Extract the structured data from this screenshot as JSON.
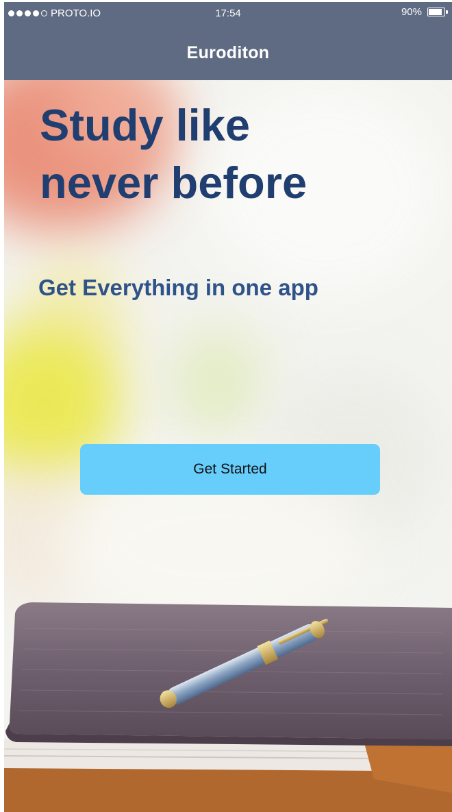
{
  "status_bar": {
    "carrier": "PROTO.IO",
    "time": "17:54",
    "battery": "90%"
  },
  "header": {
    "title": "Euroditon"
  },
  "hero": {
    "headline_line1": "Study like",
    "headline_line2": "never before",
    "subheadline": "Get Everything in one app",
    "cta_label": "Get Started"
  },
  "colors": {
    "header_bg": "#5f6b82",
    "headline": "#203e70",
    "subheadline": "#2f5289",
    "cta_bg": "#67cdfb"
  }
}
